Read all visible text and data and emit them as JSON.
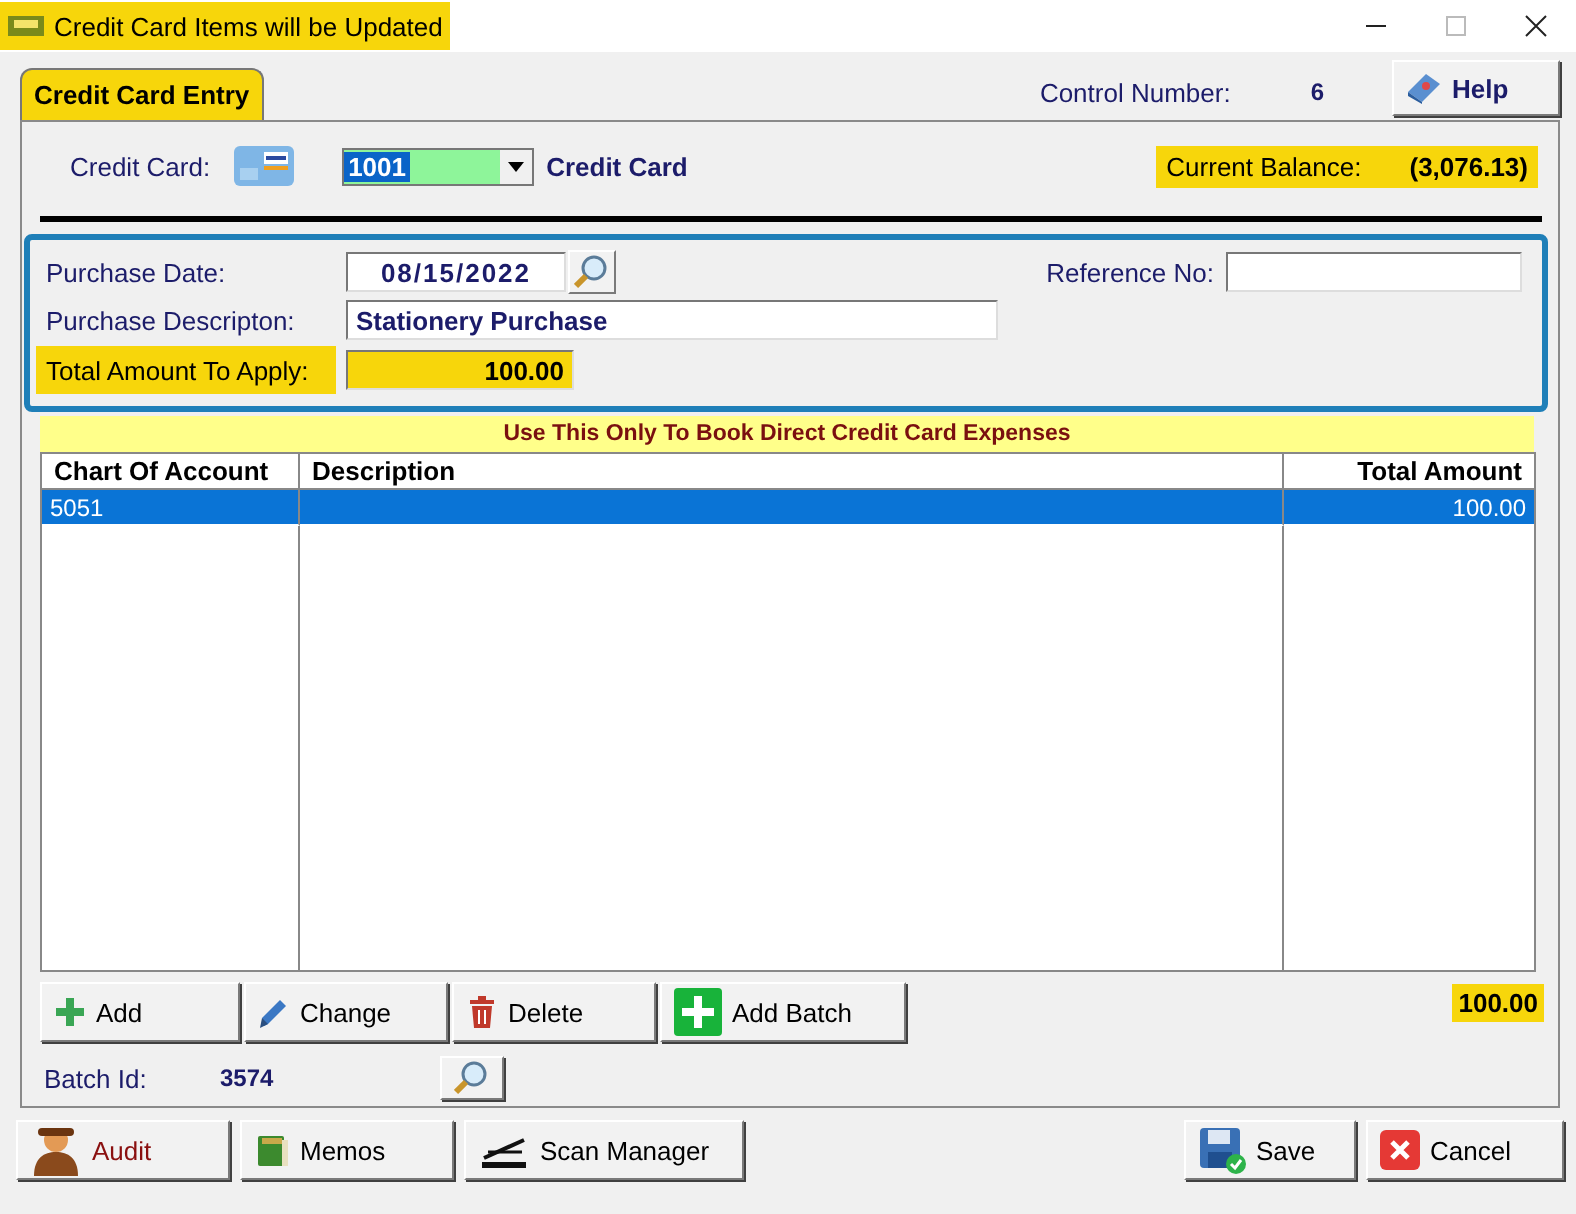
{
  "window": {
    "title": "Credit Card Items will be Updated"
  },
  "tabs": [
    {
      "label": "Credit Card Entry",
      "selected": true
    }
  ],
  "control_number": {
    "label": "Control Number:",
    "value": "6"
  },
  "help_button": {
    "label": "Help"
  },
  "credit_card": {
    "label": "Credit Card:",
    "value": "1001",
    "name": "Credit Card"
  },
  "current_balance": {
    "label": "Current Balance:",
    "value": "(3,076.13)"
  },
  "purchase": {
    "date_label": "Purchase Date:",
    "date": "08/15/2022",
    "reference_label": "Reference No:",
    "description_label": "Purchase Descripton:",
    "description": "Stationery Purchase",
    "total_label": "Total Amount To Apply:",
    "total": "100.00"
  },
  "banner": "Use This Only To Book Direct Credit Card Expenses",
  "table": {
    "columns": [
      "Chart Of Account",
      "Description",
      "Total Amount"
    ],
    "rows": [
      {
        "account": "5051",
        "amount": "100.00",
        "selected": true
      }
    ]
  },
  "table_total": "100.00",
  "grid_buttons": [
    {
      "label": "Add",
      "kind": "add"
    },
    {
      "label": "Change",
      "kind": "change"
    },
    {
      "label": "Delete",
      "kind": "delete"
    },
    {
      "label": "Add Batch",
      "kind": "batch"
    }
  ],
  "batch": {
    "label": "Batch Id:",
    "value": "3574"
  },
  "bottom_buttons": [
    {
      "label": "Audit",
      "kind": "audit"
    },
    {
      "label": "Memos",
      "kind": "memos"
    },
    {
      "label": "Scan Manager",
      "kind": "scan"
    }
  ],
  "dialog_buttons": [
    {
      "label": "Save",
      "kind": "save"
    },
    {
      "label": "Cancel",
      "kind": "cancel"
    }
  ]
}
